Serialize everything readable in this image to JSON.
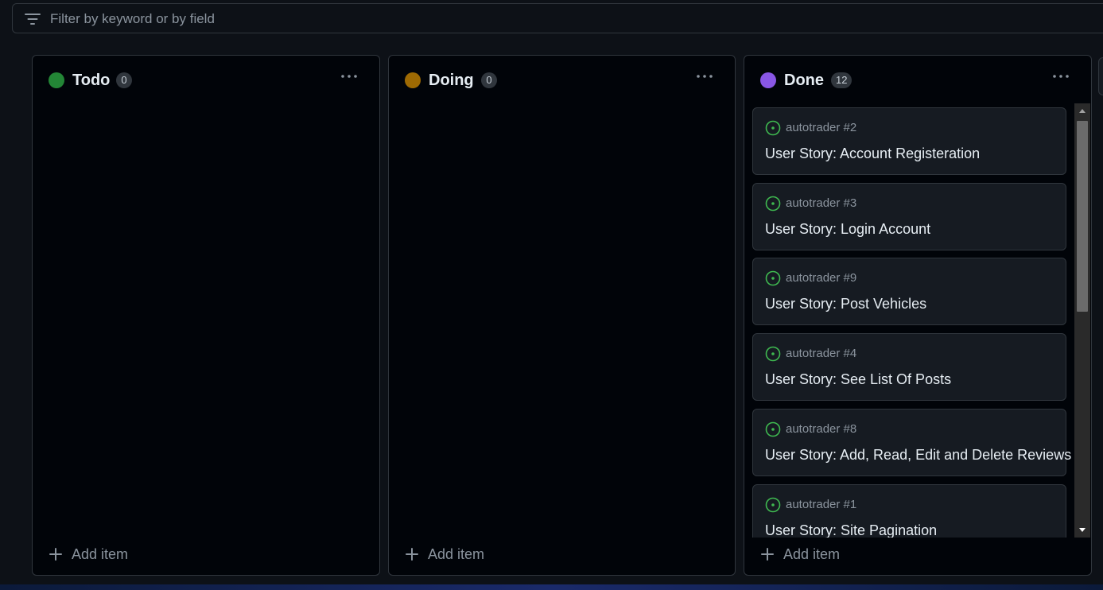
{
  "filter": {
    "placeholder": "Filter by keyword or by field"
  },
  "columns": [
    {
      "title": "Todo",
      "count": "0",
      "color": "#238636",
      "add_label": "Add item"
    },
    {
      "title": "Doing",
      "count": "0",
      "color": "#9e6a03",
      "add_label": "Add item"
    },
    {
      "title": "Done",
      "count": "12",
      "color": "#8957e5",
      "add_label": "Add item",
      "cards": [
        {
          "repo": "autotrader #2",
          "title": "User Story: Account Registeration"
        },
        {
          "repo": "autotrader #3",
          "title": "User Story: Login Account"
        },
        {
          "repo": "autotrader #9",
          "title": "User Story: Post Vehicles"
        },
        {
          "repo": "autotrader #4",
          "title": "User Story: See List Of Posts"
        },
        {
          "repo": "autotrader #8",
          "title": "User Story: Add, Read, Edit and Delete Reviews"
        },
        {
          "repo": "autotrader #1",
          "title": "User Story: Site Pagination"
        }
      ]
    }
  ],
  "icons": {
    "filter": "filter-icon",
    "menu": "kebab-horizontal-icon",
    "add": "plus-icon",
    "issue": "issue-opened-icon"
  },
  "colors": {
    "issue_open": "#3fb950"
  }
}
